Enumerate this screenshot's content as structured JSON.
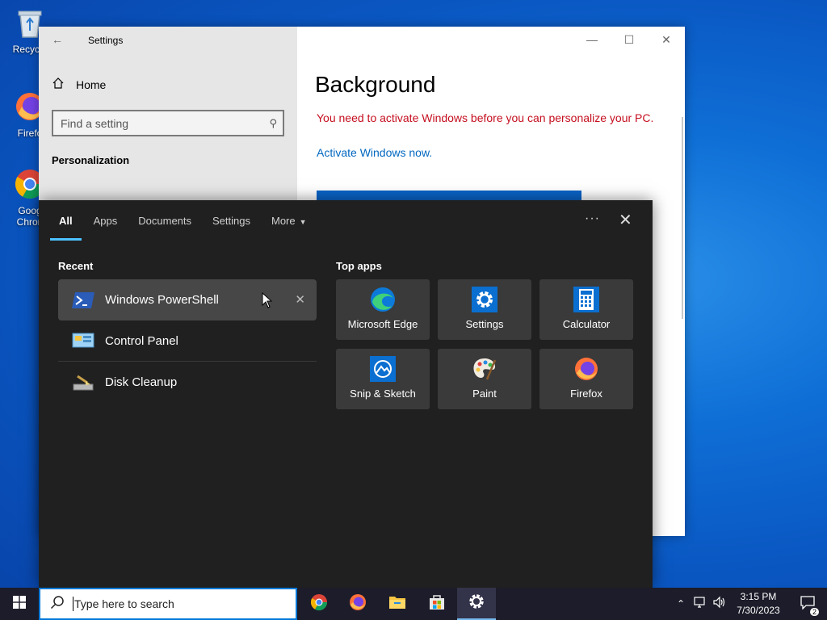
{
  "desktop": {
    "icons": [
      {
        "label": "Recycle",
        "icon": "recycle-bin-icon"
      },
      {
        "label": "Firefo",
        "icon": "firefox-icon"
      },
      {
        "label": "Goog",
        "label2": "Chron",
        "icon": "chrome-icon"
      }
    ]
  },
  "settings_window": {
    "title": "Settings",
    "back_icon": "back-arrow-icon",
    "home_label": "Home",
    "search_placeholder": "Find a setting",
    "section_label": "Personalization",
    "page_title": "Background",
    "warning_text": "You need to activate Windows before you can personalize your PC.",
    "activate_link": "Activate Windows now.",
    "window_controls": [
      "minimize",
      "maximize",
      "close"
    ]
  },
  "search_panel": {
    "tabs": [
      {
        "label": "All",
        "active": true
      },
      {
        "label": "Apps"
      },
      {
        "label": "Documents"
      },
      {
        "label": "Settings"
      },
      {
        "label": "More",
        "has_dropdown": true
      }
    ],
    "more_options_icon": "ellipsis-icon",
    "close_icon": "close-icon",
    "recent_label": "Recent",
    "recent": [
      {
        "label": "Windows PowerShell",
        "icon": "powershell-icon",
        "selected": true
      },
      {
        "label": "Control Panel",
        "icon": "control-panel-icon"
      },
      {
        "label": "Disk Cleanup",
        "icon": "disk-cleanup-icon"
      }
    ],
    "top_apps_label": "Top apps",
    "top_apps": [
      {
        "label": "Microsoft Edge",
        "icon": "edge-icon"
      },
      {
        "label": "Settings",
        "icon": "settings-gear-icon"
      },
      {
        "label": "Calculator",
        "icon": "calculator-icon"
      },
      {
        "label": "Snip & Sketch",
        "icon": "snip-sketch-icon"
      },
      {
        "label": "Paint",
        "icon": "paint-icon"
      },
      {
        "label": "Firefox",
        "icon": "firefox-icon"
      }
    ]
  },
  "taskbar": {
    "search_placeholder": "Type here to search",
    "pinned": [
      "chrome-icon",
      "firefox-icon",
      "file-explorer-icon",
      "store-icon",
      "settings-gear-icon"
    ],
    "active_app": "settings-gear-icon",
    "clock": {
      "time": "3:15 PM",
      "date": "7/30/2023"
    },
    "notification_count": "2"
  },
  "colors": {
    "accent": "#4cc2ff",
    "warning": "#c50f1f",
    "link": "#0067c0",
    "panel_bg": "#202020"
  }
}
